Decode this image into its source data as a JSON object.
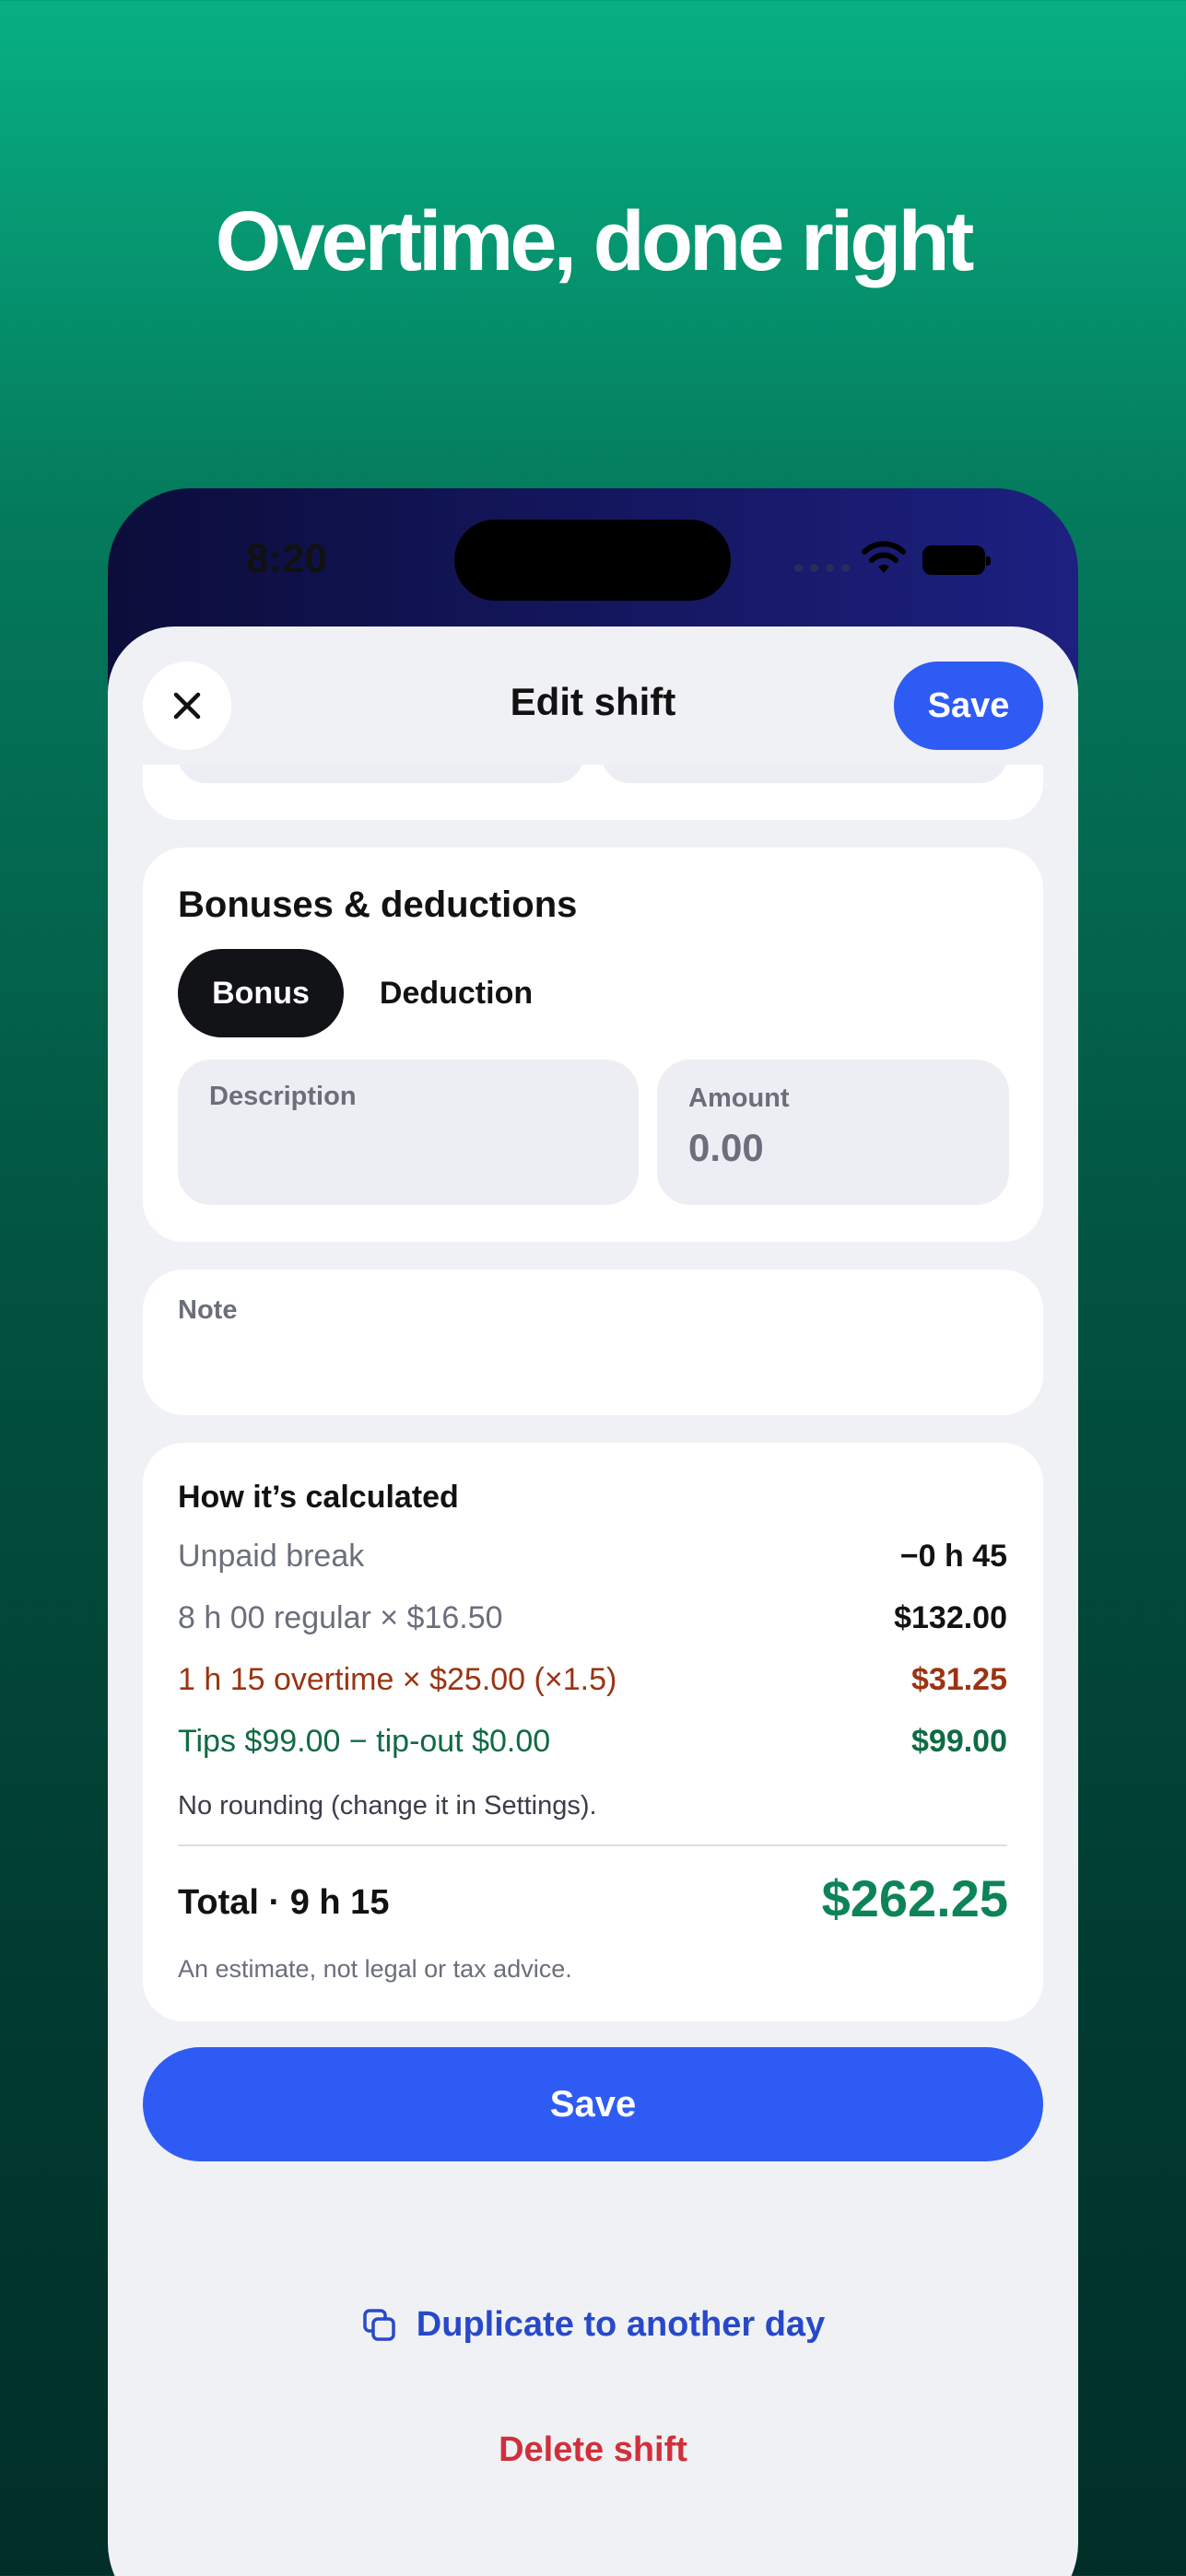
{
  "hero": {
    "title": "Overtime, done right"
  },
  "status_bar": {
    "time": "8:20"
  },
  "header": {
    "title": "Edit shift",
    "save_label": "Save"
  },
  "bonuses": {
    "heading": "Bonuses & deductions",
    "segments": [
      "Bonus",
      "Deduction"
    ],
    "selected_segment": "Bonus",
    "description": {
      "label": "Description",
      "value": ""
    },
    "amount": {
      "label": "Amount",
      "placeholder": "0.00"
    }
  },
  "note": {
    "label": "Note",
    "value": ""
  },
  "calc": {
    "heading": "How it’s calculated",
    "rows": [
      {
        "label": "Unpaid break",
        "value": "−0 h 45"
      },
      {
        "label": "8 h 00 regular × $16.50",
        "value": "$132.00"
      },
      {
        "label": "1 h 15 overtime × $25.00 (×1.5)",
        "value": "$31.25"
      },
      {
        "label": "Tips $99.00 − tip-out $0.00",
        "value": "$99.00"
      }
    ],
    "rounding_note": "No rounding (change it in Settings).",
    "total_label": "Total · 9 h 15",
    "total_value": "$262.25",
    "disclaimer": "An estimate, not legal or tax advice."
  },
  "actions": {
    "save_label": "Save",
    "duplicate_label": "Duplicate to another day",
    "delete_label": "Delete shift"
  },
  "colors": {
    "accent": "#2f5bf5",
    "overtime": "#9a3412",
    "tips": "#0f6b43",
    "total": "#0c8457",
    "danger": "#d0303a"
  },
  "icons": [
    "close-icon",
    "wifi-icon",
    "battery-icon",
    "copy-icon"
  ]
}
